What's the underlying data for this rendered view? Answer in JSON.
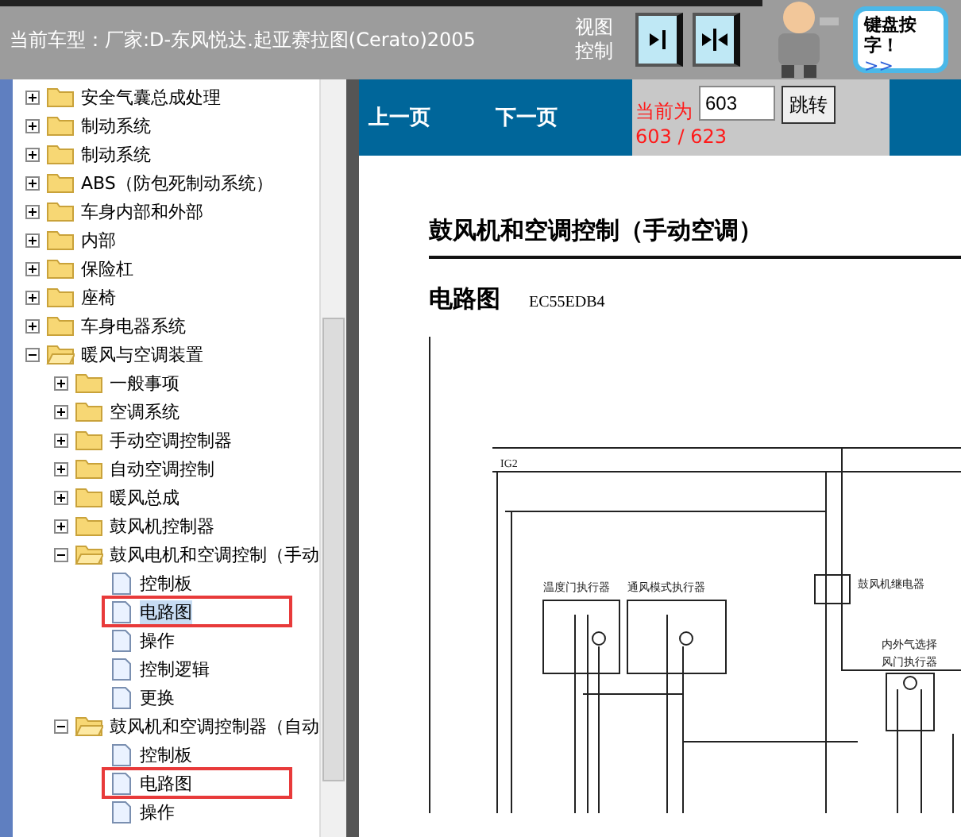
{
  "header": {
    "title": "当前车型：厂家:D-东风悦达.起亚赛拉图(Cerato)2005",
    "view_label": "视图控制",
    "view_buttons": [
      {
        "kind": "expand",
        "selected": false
      },
      {
        "kind": "split",
        "selected": false
      }
    ],
    "bubble": {
      "lines": [
        "键盘按",
        "字！"
      ],
      "link": ">>"
    }
  },
  "tree": [
    {
      "label": "安全气囊总成处理",
      "kind": "folder",
      "expanded": false
    },
    {
      "label": "制动系统",
      "kind": "folder",
      "expanded": false
    },
    {
      "label": "制动系统",
      "kind": "folder",
      "expanded": false
    },
    {
      "label": "ABS（防包死制动系统）",
      "kind": "folder",
      "expanded": false
    },
    {
      "label": "车身内部和外部",
      "kind": "folder",
      "expanded": false
    },
    {
      "label": "内部",
      "kind": "folder",
      "expanded": false
    },
    {
      "label": "保险杠",
      "kind": "folder",
      "expanded": false
    },
    {
      "label": "座椅",
      "kind": "folder",
      "expanded": false
    },
    {
      "label": "车身电器系统",
      "kind": "folder",
      "expanded": false
    },
    {
      "label": "暖风与空调装置",
      "kind": "folder",
      "expanded": true,
      "children": [
        {
          "label": "一般事项",
          "kind": "folder",
          "expanded": false
        },
        {
          "label": "空调系统",
          "kind": "folder",
          "expanded": false
        },
        {
          "label": "手动空调控制器",
          "kind": "folder",
          "expanded": false
        },
        {
          "label": "自动空调控制",
          "kind": "folder",
          "expanded": false
        },
        {
          "label": "暖风总成",
          "kind": "folder",
          "expanded": false
        },
        {
          "label": "鼓风机控制器",
          "kind": "folder",
          "expanded": false
        },
        {
          "label": "鼓风电机和空调控制（手动",
          "kind": "folder",
          "expanded": true,
          "children": [
            {
              "label": "控制板",
              "kind": "page",
              "selected": false,
              "marked": false
            },
            {
              "label": "电路图",
              "kind": "page",
              "selected": true,
              "marked": true
            },
            {
              "label": "操作",
              "kind": "page",
              "selected": false,
              "marked": false
            },
            {
              "label": "控制逻辑",
              "kind": "page",
              "selected": false,
              "marked": false
            },
            {
              "label": "更换",
              "kind": "page",
              "selected": false,
              "marked": false
            }
          ]
        },
        {
          "label": "鼓风机和空调控制器（自动",
          "kind": "folder",
          "expanded": true,
          "children": [
            {
              "label": "控制板",
              "kind": "page",
              "selected": false,
              "marked": false
            },
            {
              "label": "电路图",
              "kind": "page",
              "selected": false,
              "marked": true
            },
            {
              "label": "操作",
              "kind": "page",
              "selected": false,
              "marked": false
            }
          ]
        }
      ]
    }
  ],
  "nav": {
    "prev": "上一页",
    "next": "下一页",
    "current_label": "当前为",
    "page_value": "603",
    "go_button": "跳转",
    "page_count": "603 / 623"
  },
  "document": {
    "title": "鼓风机和空调控制（手动空调）",
    "section": "电路图",
    "code": "EC55EDB4",
    "diagram_labels": [
      "IG2",
      "温度门执行器",
      "通风模式执行器",
      "鼓风机继电器",
      "内外气选择",
      "风门执行器"
    ]
  }
}
